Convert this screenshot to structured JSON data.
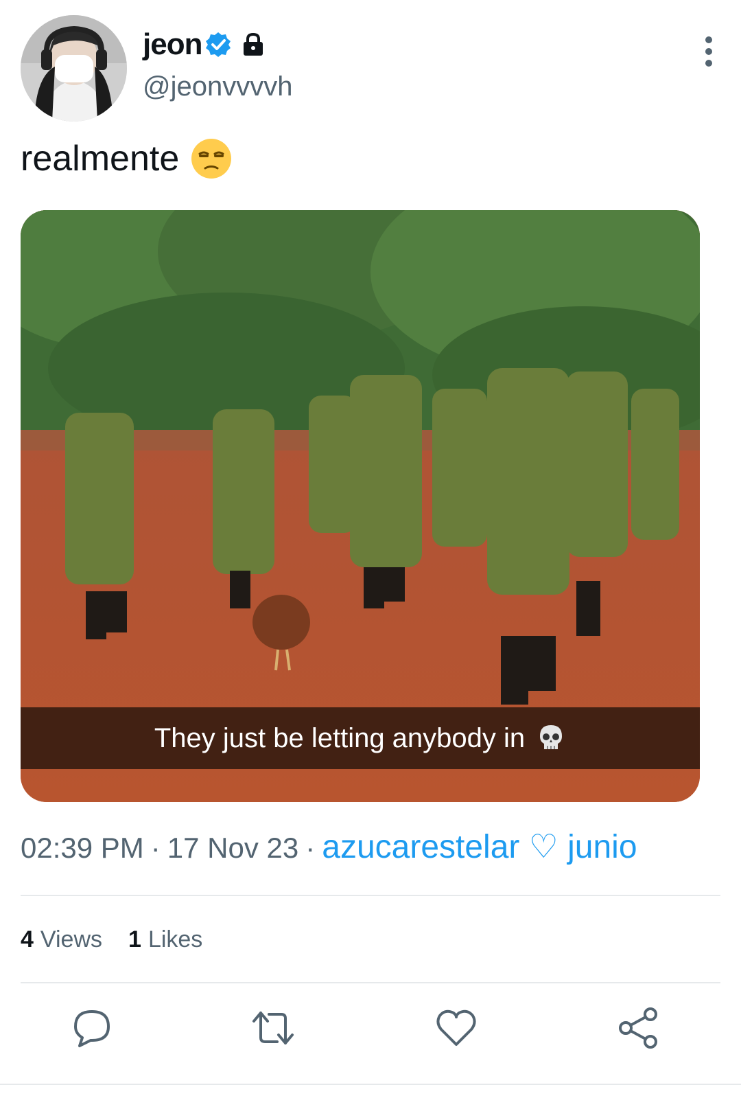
{
  "author": {
    "display_name": "jeon",
    "handle": "@jeonvvvvh",
    "verified": true,
    "protected": true
  },
  "tweet": {
    "text": "realmente",
    "text_emoji": "unamused-face-emoji",
    "image_caption": "They just be letting anybody in",
    "image_caption_emoji": "skull-emoji",
    "time": "02:39 PM",
    "date": "17 Nov 23",
    "source": "azucarestelar ♡ junio"
  },
  "stats": {
    "views_count": "4",
    "views_label": "Views",
    "likes_count": "1",
    "likes_label": "Likes"
  },
  "icons": {
    "reply": "reply-icon",
    "retweet": "retweet-icon",
    "like": "heart-icon",
    "share": "share-icon",
    "more": "more-vertical-icon"
  },
  "colors": {
    "accent": "#1d9bf0",
    "secondary_text": "#536471",
    "primary_text": "#0f1419",
    "divider": "#e6e9eb"
  }
}
